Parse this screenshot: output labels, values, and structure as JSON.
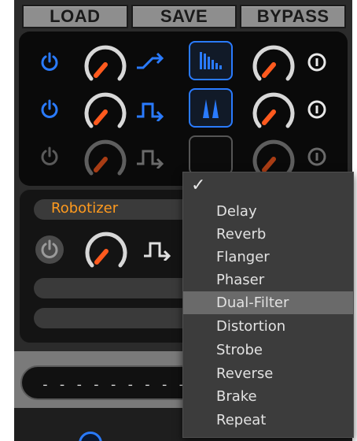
{
  "toolbar": {
    "load_label": "LOAD",
    "save_label": "SAVE",
    "bypass_label": "BYPASS"
  },
  "effect_rows": [
    {
      "enabled": true,
      "mode_icon": "ramp-icon",
      "selector_icon": "spectrum-bars-icon",
      "accent": "#2a7bff"
    },
    {
      "enabled": true,
      "mode_icon": "pulse-icon",
      "selector_icon": "dual-peak-icon",
      "accent": "#2a7bff"
    },
    {
      "enabled": false,
      "mode_icon": "pulse-icon",
      "selector_icon": "empty-icon",
      "accent": "#555555"
    }
  ],
  "slot": {
    "name": "Robotizer",
    "name_color": "#ff9a1e"
  },
  "bottom": {
    "display_text": "- - - - - - - - - - - - -"
  },
  "menu": {
    "check": "✓",
    "items": [
      "Delay",
      "Reverb",
      "Flanger",
      "Phaser",
      "Dual-Filter",
      "Distortion",
      "Strobe",
      "Reverse",
      "Brake",
      "Repeat"
    ],
    "highlighted": "Dual-Filter"
  },
  "colors": {
    "accent_blue": "#2a7bff",
    "knob_orange": "#ff5a1e",
    "panel_bg": "#0a0a0a"
  }
}
